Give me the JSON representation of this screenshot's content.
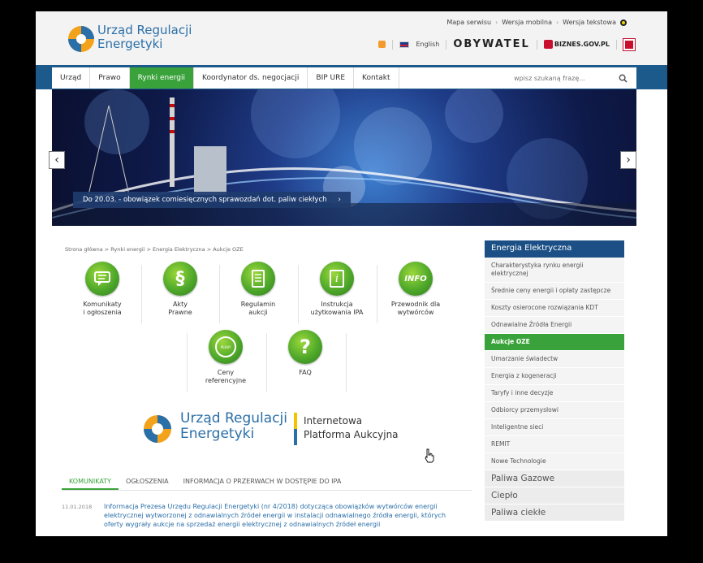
{
  "header": {
    "logo_line1": "Urząd Regulacji",
    "logo_line2": "Energetyki",
    "top_links": [
      "Mapa serwisu",
      "Wersja mobilna",
      "Wersja tekstowa"
    ],
    "english": "English",
    "obywatel": "OBYWATEL",
    "biznes": "BIZNES.GOV.PL"
  },
  "nav": {
    "items": [
      {
        "label": "Urząd"
      },
      {
        "label": "Prawo"
      },
      {
        "label": "Rynki energii"
      },
      {
        "label": "Koordynator ds. negocjacji"
      },
      {
        "label": "BIP URE"
      },
      {
        "label": "Kontakt"
      }
    ],
    "active_index": 2,
    "search_placeholder": "wpisz szukaną frazę..."
  },
  "banner": {
    "caption": "Do 20.03. - obowiązek comiesięcznych sprawozdań dot. paliw ciekłych",
    "caption_arrow": "›",
    "prev": "‹",
    "next": "›"
  },
  "breadcrumb": "Strona główna > Rynki energii > Energia Elektryczna > Aukcje OZE",
  "tiles": [
    {
      "label": "Komunikaty\ni ogłoszenia",
      "icon": "speech-bubble-icon"
    },
    {
      "label": "Akty\nPrawne",
      "icon": "paragraph-icon",
      "glyph": "§"
    },
    {
      "label": "Regulamin\naukcji",
      "icon": "document-icon"
    },
    {
      "label": "Instrukcja\nużytkowania IPA",
      "icon": "info-document-icon",
      "glyph": "i"
    },
    {
      "label": "Przewodnik dla\nwytwórców",
      "icon": "info-badge-icon",
      "glyph": "INFO"
    },
    {
      "label": "Ceny\nreferencyjne",
      "icon": "gauge-icon",
      "glyph": "PEŁNY"
    },
    {
      "label": "FAQ",
      "icon": "question-icon",
      "glyph": "?"
    }
  ],
  "ipa": {
    "name_line1": "Urząd Regulacji",
    "name_line2": "Energetyki",
    "sub_line1": "Internetowa",
    "sub_line2": "Platforma Aukcyjna"
  },
  "tabs": {
    "items": [
      "KOMUNIKATY",
      "OGŁOSZENIA",
      "INFORMACJA O PRZERWACH W DOSTĘPIE DO IPA"
    ],
    "active_index": 0
  },
  "news": [
    {
      "date": "11.01.2018",
      "text": "Informacja Prezesa Urzędu Regulacji Energetyki (nr 4/2018) dotycząca obowiązków wytwórców energii elektrycznej wytworzonej z odnawialnych źródeł energii w instalacji odnawialnego źródła energii, których oferty wygrały aukcje na sprzedaż energii elektrycznej z odnawialnych źródeł energii"
    }
  ],
  "sidebar": {
    "heading": "Energia Elektryczna",
    "items": [
      "Charakterystyka rynku energii elektrycznej",
      "Średnie ceny energii i opłaty zastępcze",
      "Koszty osierocone rozwiązania KDT",
      "Odnawialne Źródła Energii",
      "Aukcje OZE",
      "Umarzanie świadectw",
      "Energia z kogeneracji",
      "Taryfy i inne decyzje",
      "Odbiorcy przemysłowi",
      "Inteligentne sieci",
      "REMIT",
      "Nowe Technologie"
    ],
    "active_index": 4,
    "sections": [
      "Paliwa Gazowe",
      "Ciepło",
      "Paliwa ciekłe"
    ]
  },
  "colors": {
    "brand_blue": "#2b6fa8",
    "nav_bar": "#1b5a8a",
    "accent_green": "#3aa23a",
    "sidebar_head": "#1b4f85"
  }
}
